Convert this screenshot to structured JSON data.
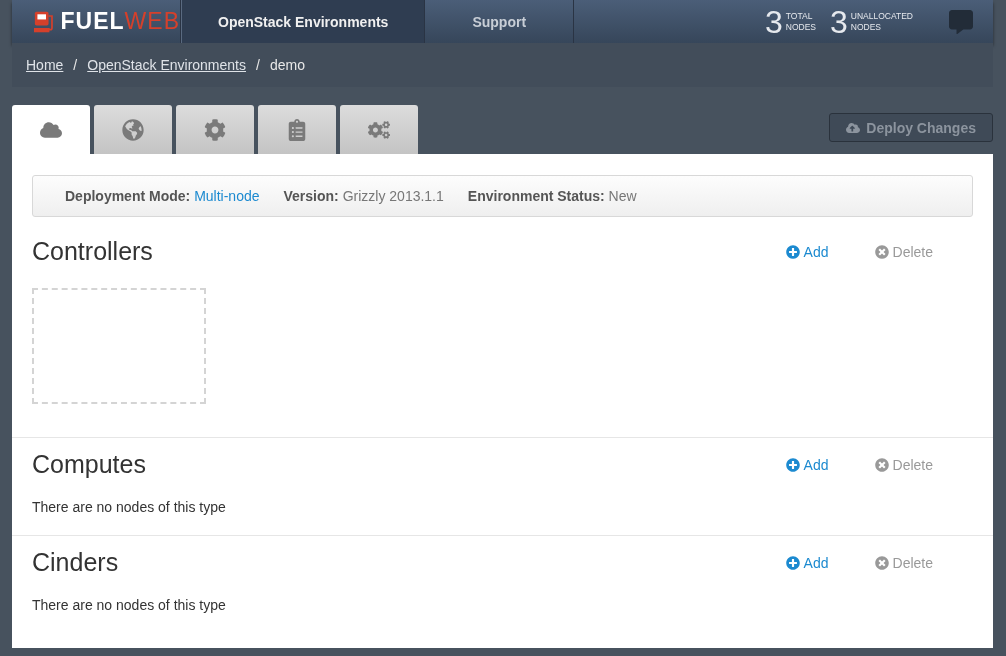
{
  "navbar": {
    "logo": {
      "part_1": "FUEL",
      "part_2": "WEB"
    },
    "items": [
      {
        "label": "OpenStack Environments",
        "selected": true
      },
      {
        "label": "Support",
        "selected": false
      }
    ],
    "stats": [
      {
        "count": "3",
        "line_1": "TOTAL",
        "line_2": "NODES"
      },
      {
        "count": "3",
        "line_1": "UNALLOCATED",
        "line_2": "NODES"
      }
    ]
  },
  "breadcrumb": {
    "links": [
      "Home",
      "OpenStack Environments"
    ],
    "separators": [
      "/",
      "/"
    ],
    "current": "demo"
  },
  "tabs": [
    {
      "selected": true
    },
    {
      "selected": false
    },
    {
      "selected": false
    },
    {
      "selected": false
    },
    {
      "selected": false
    }
  ],
  "deploy_button": {
    "label": "Deploy Changes",
    "disabled": true
  },
  "info_bar": [
    {
      "label": "Deployment Mode:",
      "value": "Multi-node",
      "link": true
    },
    {
      "label": "Version:",
      "value": "Grizzly 2013.1.1",
      "link": false
    },
    {
      "label": "Environment Status:",
      "value": "New",
      "link": false
    }
  ],
  "sections": [
    {
      "title": "Controllers",
      "kind": "slot",
      "add": "Add",
      "delete": "Delete"
    },
    {
      "title": "Computes",
      "kind": "empty",
      "message": "There are no nodes of this type",
      "add": "Add",
      "delete": "Delete"
    },
    {
      "title": "Cinders",
      "kind": "empty",
      "message": "There are no nodes of this type",
      "add": "Add",
      "delete": "Delete"
    }
  ]
}
